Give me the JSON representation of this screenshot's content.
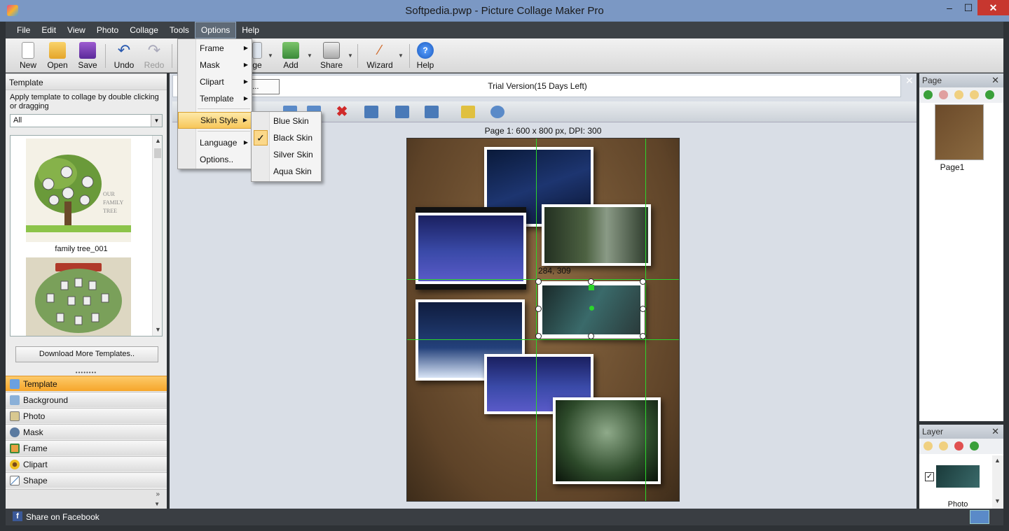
{
  "window": {
    "title": "Softpedia.pwp - Picture Collage Maker Pro",
    "min": "–",
    "max": "☐",
    "close": "✕"
  },
  "menubar": [
    "File",
    "Edit",
    "View",
    "Photo",
    "Collage",
    "Tools",
    "Options",
    "Help"
  ],
  "toolbar": {
    "new": "New",
    "open": "Open",
    "save": "Save",
    "undo": "Undo",
    "redo": "Redo",
    "image": "ge",
    "add": "Add",
    "share": "Share",
    "wizard": "Wizard",
    "help": "Help"
  },
  "options_menu": {
    "items": [
      "Frame",
      "Mask",
      "Clipart",
      "Template",
      "Skin Style",
      "Language",
      "Options.."
    ]
  },
  "skin_menu": {
    "items": [
      "Blue Skin",
      "Black Skin",
      "Silver Skin",
      "Aqua Skin"
    ],
    "checked": "✓"
  },
  "template_panel": {
    "header": "Template",
    "description": "Apply template to collage by double clicking or dragging",
    "filter": "All",
    "items": [
      {
        "caption": "family tree_001"
      }
    ],
    "download_button": "Download More Templates.."
  },
  "nav": {
    "items": [
      "Template",
      "Background",
      "Photo",
      "Mask",
      "Frame",
      "Clipart",
      "Shape"
    ],
    "active": "Template",
    "more": "»"
  },
  "trial": {
    "text": "Trial Version(15 Days Left)",
    "button": "on...",
    "close": "✕"
  },
  "canvas": {
    "info": "Page 1: 600 x 800 px, DPI: 300",
    "coords": "284, 309"
  },
  "page_panel": {
    "header": "Page",
    "close": "✕",
    "thumb_caption": "Page1"
  },
  "layer_panel": {
    "header": "Layer",
    "close": "✕",
    "check": "✓",
    "thumb_caption": "Photo"
  },
  "status": {
    "facebook_icon": "f",
    "share": "Share on Facebook"
  },
  "colors": {
    "accent": "#f6a62a",
    "guide": "#2bd62b",
    "titlebar": "#7b98c4",
    "close": "#c7372f"
  }
}
